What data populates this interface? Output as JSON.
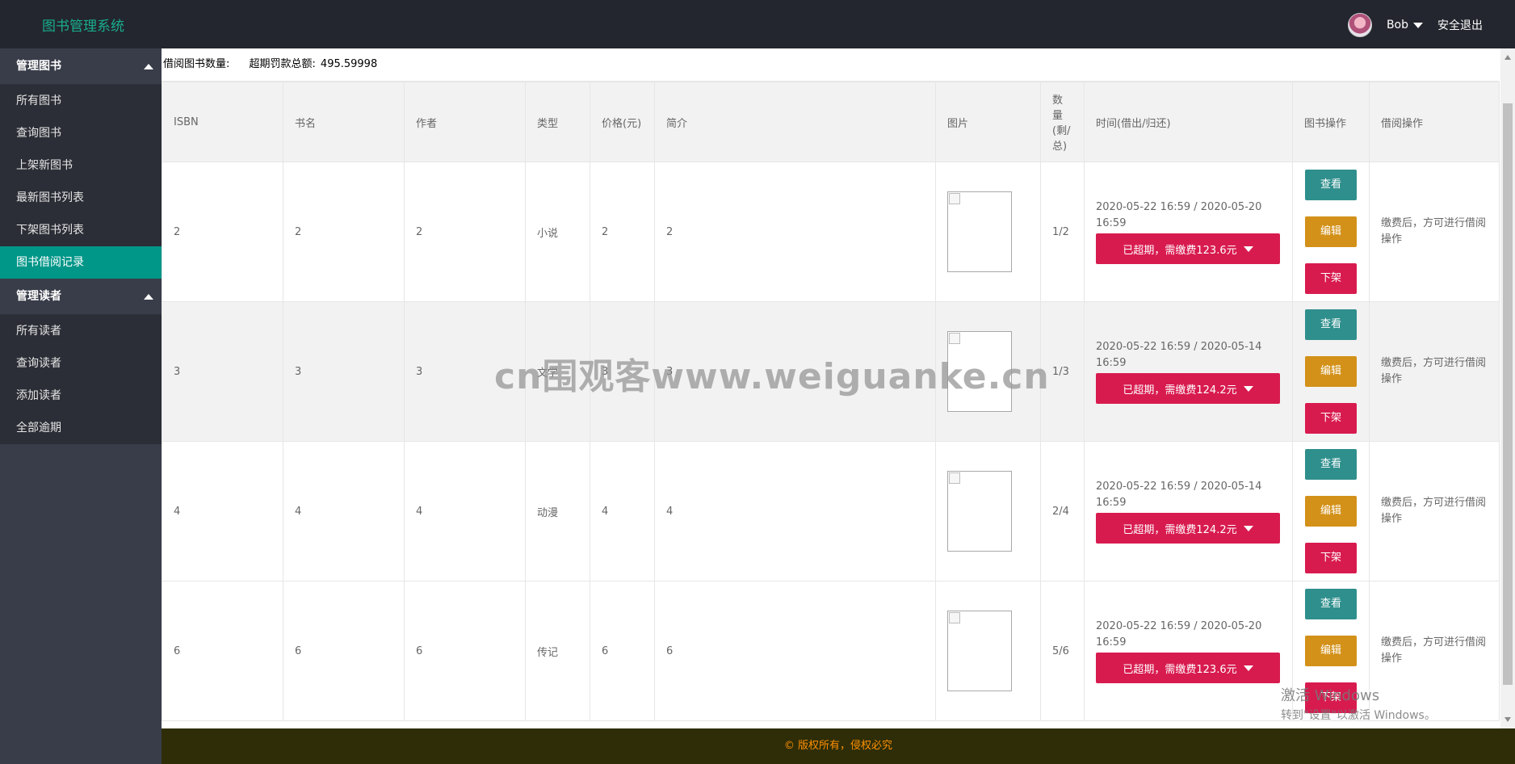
{
  "header": {
    "brand": "图书管理系统",
    "user_name": "Bob",
    "logout_label": "安全退出"
  },
  "sidebar": {
    "groups": [
      {
        "title": "管理图书",
        "items": [
          "所有图书",
          "查询图书",
          "上架新图书",
          "最新图书列表",
          "下架图书列表",
          "图书借阅记录"
        ]
      },
      {
        "title": "管理读者",
        "items": [
          "所有读者",
          "查询读者",
          "添加读者",
          "全部逾期"
        ]
      }
    ],
    "active_item": "图书借阅记录"
  },
  "summary": {
    "borrow_count_label": "借阅图书数量:",
    "fine_total_label": "超期罚款总额:",
    "fine_total_value": "495.59998"
  },
  "table": {
    "headers": [
      "ISBN",
      "书名",
      "作者",
      "类型",
      "价格(元)",
      "简介",
      "图片",
      "数量(剩/总)",
      "时间(借出/归还)",
      "图书操作",
      "借阅操作"
    ],
    "rows": [
      {
        "isbn": "2",
        "name": "2",
        "author": "2",
        "type": "小说",
        "price": "2",
        "intro": "2",
        "qty": "1/2",
        "time": "2020-05-22 16:59 / 2020-05-20 16:59",
        "status": "已超期，需缴费123.6元",
        "ops": [
          "查看",
          "编辑",
          "下架"
        ],
        "borrow_note": "缴费后，方可进行借阅操作"
      },
      {
        "isbn": "3",
        "name": "3",
        "author": "3",
        "type": "文学",
        "price": "3",
        "intro": "3",
        "qty": "1/3",
        "time": "2020-05-22 16:59 / 2020-05-14 16:59",
        "status": "已超期，需缴费124.2元",
        "ops": [
          "查看",
          "编辑",
          "下架"
        ],
        "borrow_note": "缴费后，方可进行借阅操作"
      },
      {
        "isbn": "4",
        "name": "4",
        "author": "4",
        "type": "动漫",
        "price": "4",
        "intro": "4",
        "qty": "2/4",
        "time": "2020-05-22 16:59 / 2020-05-14 16:59",
        "status": "已超期，需缴费124.2元",
        "ops": [
          "查看",
          "编辑",
          "下架"
        ],
        "borrow_note": "缴费后，方可进行借阅操作"
      },
      {
        "isbn": "6",
        "name": "6",
        "author": "6",
        "type": "传记",
        "price": "6",
        "intro": "6",
        "qty": "5/6",
        "time": "2020-05-22 16:59 / 2020-05-20 16:59",
        "status": "已超期，需缴费123.6元",
        "ops": [
          "查看",
          "编辑",
          "下架"
        ],
        "borrow_note": "缴费后，方可进行借阅操作"
      }
    ]
  },
  "footer": {
    "text": "© 版权所有，侵权必究"
  },
  "overlays": {
    "watermark": "cn围观客www.weiguanke.cn",
    "windows_activation_title": "激活 Windows",
    "windows_activation_sub": "转到\"设置\"以激活 Windows。"
  },
  "colors": {
    "header_bg": "#23262e",
    "brand": "#19ad8e",
    "sidebar_bg": "#393d49",
    "active_item": "#009688",
    "view_button": "#2f8f8d",
    "edit_button": "#d39119",
    "danger_button": "#d81b4f",
    "footer_bg": "#2e2d08",
    "footer_text": "#ff8f00"
  }
}
